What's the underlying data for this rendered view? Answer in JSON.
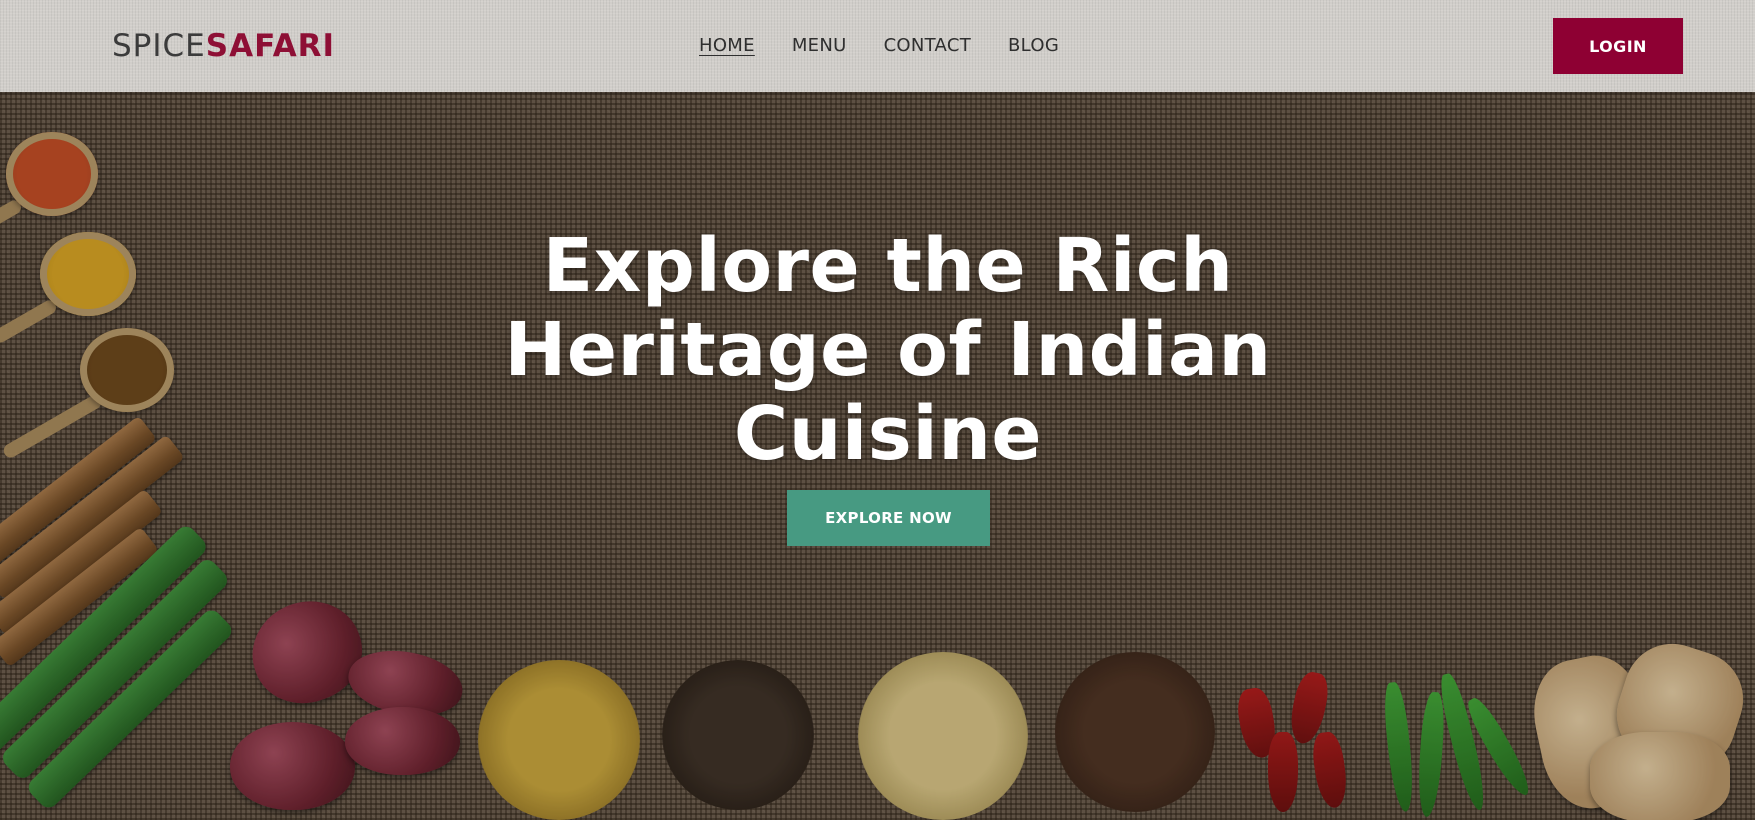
{
  "brand": {
    "part1": "SPICE",
    "part2": "SAFARI"
  },
  "nav": {
    "items": [
      {
        "label": "HOME",
        "active": true
      },
      {
        "label": "MENU",
        "active": false
      },
      {
        "label": "CONTACT",
        "active": false
      },
      {
        "label": "BLOG",
        "active": false
      }
    ]
  },
  "header": {
    "login_label": "LOGIN"
  },
  "hero": {
    "title": "Explore the Rich Heritage of Indian Cuisine",
    "cta_label": "EXPLORE NOW",
    "background": "burlap-with-spices-image"
  },
  "colors": {
    "brand_accent": "#8e0f35",
    "login_button": "#8e0033",
    "cta_button": "#479a82",
    "header_bg": "#d1ceca"
  }
}
